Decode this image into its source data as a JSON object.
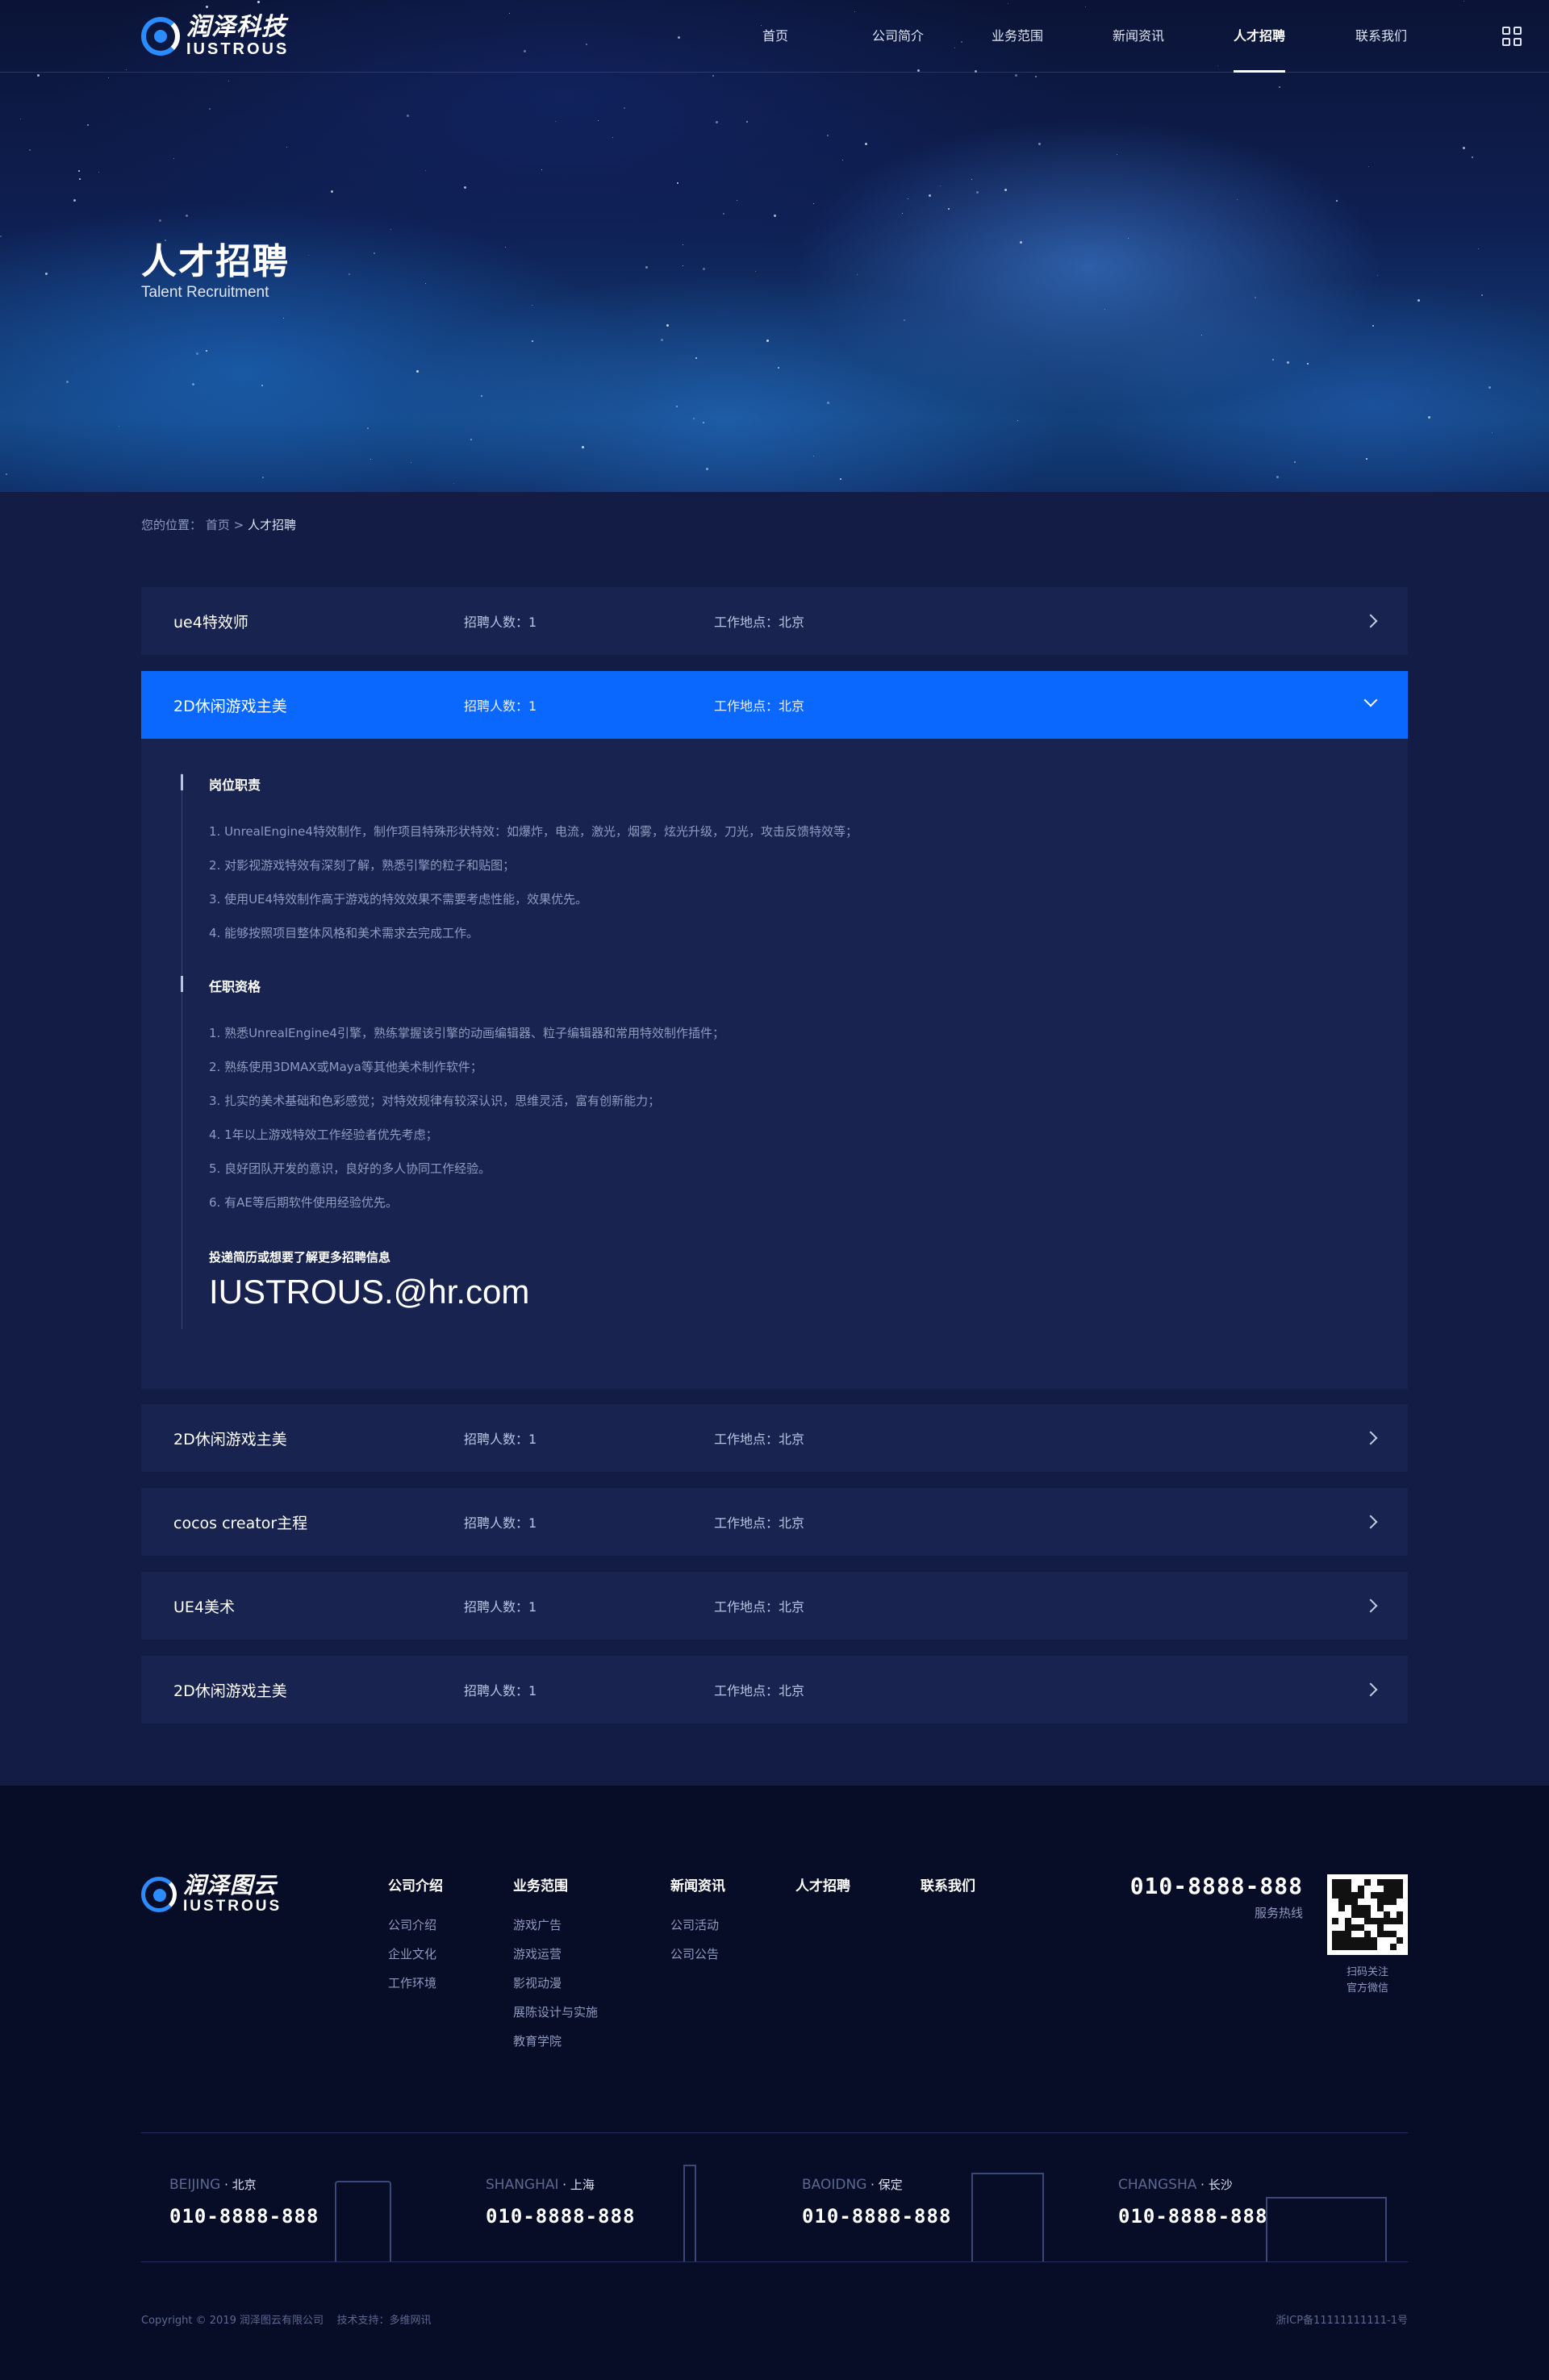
{
  "header": {
    "logo_cn": "润泽科技",
    "logo_en": "IUSTROUS",
    "nav": [
      {
        "label": "首页"
      },
      {
        "label": "公司简介"
      },
      {
        "label": "业务范围"
      },
      {
        "label": "新闻资讯"
      },
      {
        "label": "人才招聘"
      },
      {
        "label": "联系我们"
      }
    ],
    "active_nav": "人才招聘"
  },
  "hero": {
    "title": "人才招聘",
    "subtitle": "Talent Recruitment"
  },
  "breadcrumb": {
    "prefix": "您的位置：",
    "home": "首页",
    "sep": ">",
    "current": "人才招聘"
  },
  "jobs": [
    {
      "title": "ue4特效师",
      "count": "招聘人数：1",
      "location": "工作地点：北京",
      "expanded": false
    },
    {
      "title": "2D休闲游戏主美",
      "count": "招聘人数：1",
      "location": "工作地点：北京",
      "expanded": true
    },
    {
      "title": "2D休闲游戏主美",
      "count": "招聘人数：1",
      "location": "工作地点：北京",
      "expanded": false
    },
    {
      "title": "cocos creator主程",
      "count": "招聘人数：1",
      "location": "工作地点：北京",
      "expanded": false
    },
    {
      "title": "UE4美术",
      "count": "招聘人数：1",
      "location": "工作地点：北京",
      "expanded": false
    },
    {
      "title": "2D休闲游戏主美",
      "count": "招聘人数：1",
      "location": "工作地点：北京",
      "expanded": false
    }
  ],
  "detail": {
    "duties_title": "岗位职责",
    "duties": [
      "1. UnrealEngine4特效制作，制作项目特殊形状特效：如爆炸，电流，激光，烟雾，炫光升级，刀光，攻击反馈特效等；",
      "2. 对影视游戏特效有深刻了解，熟悉引擎的粒子和贴图；",
      "3. 使用UE4特效制作高于游戏的特效效果不需要考虑性能，效果优先。",
      "4. 能够按照项目整体风格和美术需求去完成工作。"
    ],
    "qual_title": "任职资格",
    "quals": [
      "1. 熟悉UnrealEngine4引擎，熟练掌握该引擎的动画编辑器、粒子编辑器和常用特效制作插件；",
      "2. 熟练使用3DMAX或Maya等其他美术制作软件；",
      "3. 扎实的美术基础和色彩感觉；对特效规律有较深认识，思维灵活，富有创新能力；",
      "4. 1年以上游戏特效工作经验者优先考虑；",
      "5. 良好团队开发的意识，良好的多人协同工作经验。",
      "6. 有AE等后期软件使用经验优先。"
    ],
    "email_label": "投递简历或想要了解更多招聘信息",
    "email": "IUSTROUS.@hr.com"
  },
  "footer": {
    "logo_cn": "润泽图云",
    "logo_en": "IUSTROUS",
    "columns": [
      {
        "title": "公司介绍",
        "links": [
          "公司介绍",
          "企业文化",
          "工作环境"
        ]
      },
      {
        "title": "业务范围",
        "links": [
          "游戏广告",
          "游戏运营",
          "影视动漫",
          "展陈设计与实施",
          "教育学院"
        ]
      },
      {
        "title": "新闻资讯",
        "links": [
          "公司活动",
          "公司公告"
        ]
      },
      {
        "title": "人才招聘",
        "links": []
      },
      {
        "title": "联系我们",
        "links": []
      }
    ],
    "hotline": "010-8888-888",
    "hotline_label": "服务热线",
    "qr_line1": "扫码关注",
    "qr_line2": "官方微信",
    "cities": [
      {
        "en": "BEIJING",
        "cn": "北京",
        "phone": "010-8888-888"
      },
      {
        "en": "SHANGHAI",
        "cn": "上海",
        "phone": "010-8888-888"
      },
      {
        "en": "BAOIDNG",
        "cn": "保定",
        "phone": "010-8888-888"
      },
      {
        "en": "CHANGSHA",
        "cn": "长沙",
        "phone": "010-8888-888"
      }
    ],
    "city_sep": " · ",
    "copyright": "Copyright © 2019 润泽图云有限公司",
    "tech_support": "技术支持：多维网讯",
    "icp": "浙ICP备11111111111-1号"
  },
  "colors": {
    "accent": "#0a68ff",
    "background": "#121c45",
    "row_bg": "#18244f",
    "footer_bg": "#070d26"
  }
}
